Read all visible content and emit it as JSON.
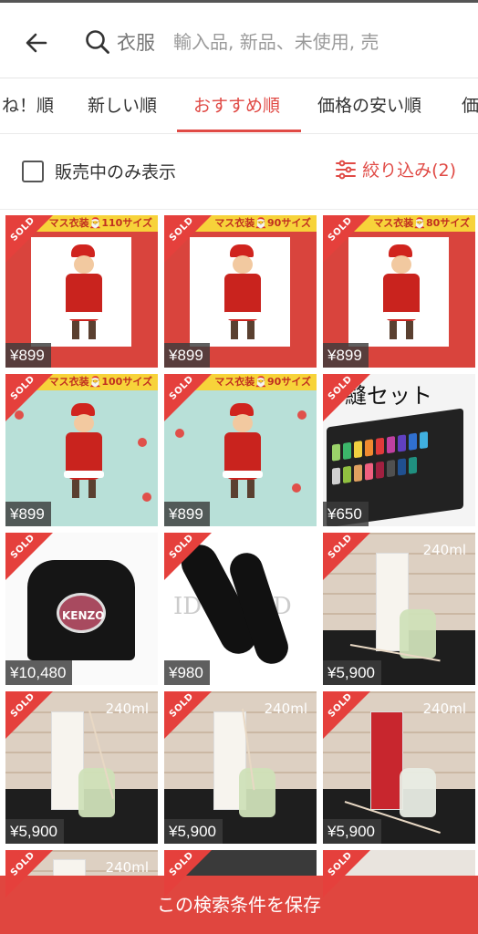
{
  "header": {
    "search_keyword": "衣服",
    "search_placeholder": "輸入品, 新品、未使用, 売"
  },
  "tabs": [
    {
      "label": "ね！順"
    },
    {
      "label": "新しい順"
    },
    {
      "label": "おすすめ順",
      "active": true
    },
    {
      "label": "価格の安い順"
    },
    {
      "label": "価"
    }
  ],
  "filter": {
    "on_sale_only_label": "販売中のみ表示",
    "refine_label": "絞り込み(2)"
  },
  "items": [
    {
      "sold_label": "SOLD",
      "price": "¥899",
      "banner": "マス衣装🎅110サイズ"
    },
    {
      "sold_label": "SOLD",
      "price": "¥899",
      "banner": "マス衣装🎅90サイズ"
    },
    {
      "sold_label": "SOLD",
      "price": "¥899",
      "banner": "マス衣装🎅80サイズ"
    },
    {
      "sold_label": "SOLD",
      "price": "¥899",
      "banner": "マス衣装🎅100サイズ"
    },
    {
      "sold_label": "SOLD",
      "price": "¥899",
      "banner": "マス衣装🎅90サイズ"
    },
    {
      "sold_label": "SOLD",
      "price": "¥650",
      "banner": "縫セット"
    },
    {
      "sold_label": "SOLD",
      "price": "¥10,480",
      "banner": "KENZO"
    },
    {
      "sold_label": "SOLD",
      "price": "¥980",
      "banner": "ID SHIAD"
    },
    {
      "sold_label": "SOLD",
      "price": "¥5,900",
      "banner": "240ml"
    },
    {
      "sold_label": "SOLD",
      "price": "¥5,900",
      "banner": "240ml"
    },
    {
      "sold_label": "SOLD",
      "price": "¥5,900",
      "banner": "240ml"
    },
    {
      "sold_label": "SOLD",
      "price": "¥5,900",
      "banner": "240ml"
    },
    {
      "sold_label": "SOLD",
      "banner": "240ml"
    },
    {
      "sold_label": "SOLD"
    },
    {
      "sold_label": "SOLD"
    }
  ],
  "save_search_label": "この検索条件を保存",
  "colors": {
    "accent": "#e04a45",
    "sold_badge": "#e5403c"
  }
}
